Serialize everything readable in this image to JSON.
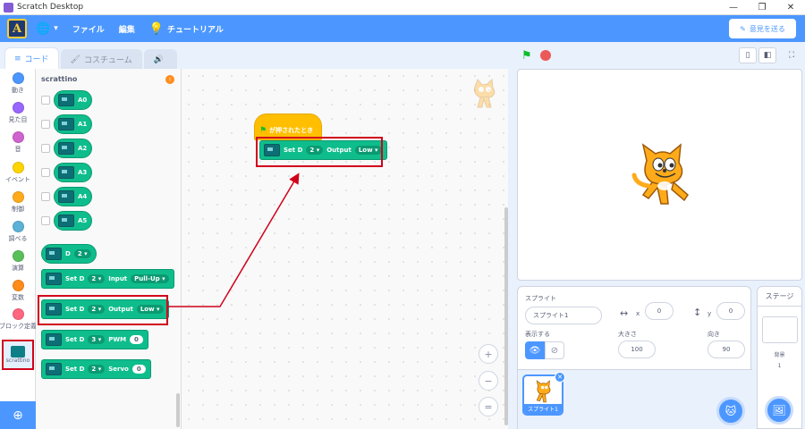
{
  "window": {
    "title": "Scratch Desktop",
    "minimize": "—",
    "maximize": "❐",
    "close": "✕"
  },
  "menubar": {
    "logo": "A",
    "language_icon": "🌐",
    "language_caret": "▾",
    "file": "ファイル",
    "edit": "編集",
    "tutorial_icon": "💡",
    "tutorial": "チュートリアル",
    "feedback_icon": "✎",
    "feedback": "意見を送る"
  },
  "tabs": [
    {
      "icon": "≡",
      "label": "コード"
    },
    {
      "icon": "🖌",
      "label": "コスチューム"
    },
    {
      "icon": "🔊",
      "label": ""
    }
  ],
  "categories": [
    {
      "label": "動き",
      "color": "#4c97ff"
    },
    {
      "label": "見た目",
      "color": "#9966ff"
    },
    {
      "label": "音",
      "color": "#cf63cf"
    },
    {
      "label": "イベント",
      "color": "#ffd500"
    },
    {
      "label": "制御",
      "color": "#ffab19"
    },
    {
      "label": "調べる",
      "color": "#5cb1d6"
    },
    {
      "label": "演算",
      "color": "#59c059"
    },
    {
      "label": "変数",
      "color": "#ff8c1a"
    },
    {
      "label": "ブロック定義",
      "color": "#ff6680"
    }
  ],
  "extension": {
    "label": "scrattino",
    "add_icon": "⊕"
  },
  "palette": {
    "title": "scrattino",
    "badge": "!",
    "reporters": [
      "A0",
      "A1",
      "A2",
      "A3",
      "A4",
      "A5"
    ],
    "digital_reporter": {
      "label": "D",
      "pin": "2"
    },
    "set_input": {
      "label": "Set D",
      "pin": "2",
      "mode_label": "Input",
      "mode": "Pull-Up"
    },
    "set_output": {
      "label": "Set D",
      "pin": "2",
      "mode_label": "Output",
      "value": "Low"
    },
    "set_pwm": {
      "label": "Set D",
      "pin": "3",
      "mode_label": "PWM",
      "value": "0"
    },
    "set_servo": {
      "label": "Set D",
      "pin": "2",
      "mode_label": "Servo",
      "value": "0"
    }
  },
  "script": {
    "hat": {
      "flag_icon": "⚑",
      "label": "が押されたとき"
    },
    "block": {
      "label": "Set D",
      "pin": "2",
      "mode_label": "Output",
      "value": "Low"
    },
    "zoom_in": "+",
    "zoom_out": "−",
    "zoom_reset": "="
  },
  "stage_controls": {
    "green_flag": "⚑",
    "small_stage": "▯",
    "large_stage": "◧",
    "fullscreen": "⛶"
  },
  "sprite_info": {
    "sprite_label": "スプライト",
    "sprite_name": "スプライト1",
    "x_icon": "↔",
    "x_label": "x",
    "x_value": "0",
    "y_icon": "↕",
    "y_label": "y",
    "y_value": "0",
    "show_label": "表示する",
    "show_icon": "👁",
    "hide_icon": "⊘",
    "size_label": "大きさ",
    "size_value": "100",
    "direction_label": "向き",
    "direction_value": "90"
  },
  "sprite_list": {
    "thumb_name": "スプライト1",
    "close": "✕",
    "add_sprite_icon": "🐱"
  },
  "stage_panel": {
    "title": "ステージ",
    "backdrop_label": "背景",
    "backdrop_count": "1",
    "add_backdrop_icon": "🖼"
  },
  "colors": {
    "accent": "#4c97ff",
    "extension_green": "#0fbd8c",
    "event_yellow": "#ffbf00",
    "highlight_red": "#d0021b"
  }
}
